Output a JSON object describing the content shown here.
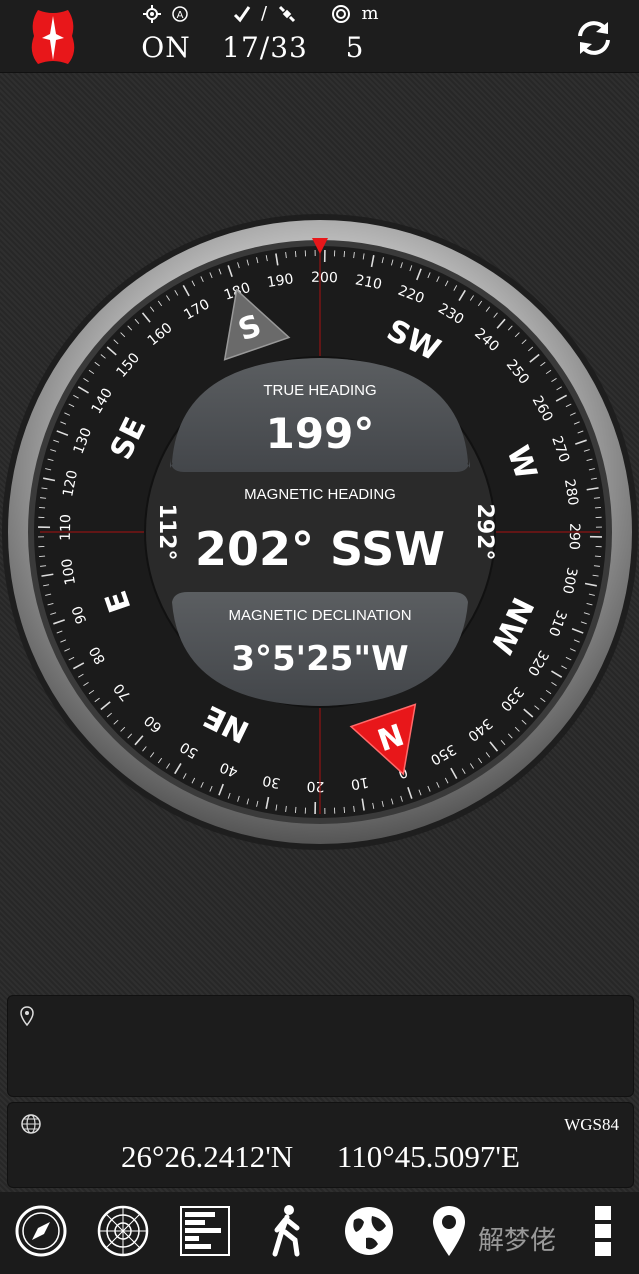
{
  "status_bar": {
    "gps_state": "ON",
    "satellites": "17/33",
    "accuracy": "5",
    "accuracy_unit": "m"
  },
  "compass": {
    "true_heading_label": "TRUE HEADING",
    "true_heading": "199°",
    "magnetic_heading_label": "MAGNETIC HEADING",
    "magnetic_heading": "202° SSW",
    "magnetic_declination_label": "MAGNETIC DECLINATION",
    "magnetic_declination": "3°5'25\"W",
    "left_bearing": "112°",
    "right_bearing": "292°",
    "rotation_deg": 199,
    "cardinals": [
      "N",
      "NE",
      "E",
      "SE",
      "S",
      "SW",
      "W",
      "NW"
    ]
  },
  "location": {
    "datum": "WGS84",
    "latitude": "26°26.2412'N",
    "longitude": "110°45.5097'E"
  },
  "bottom_nav": [
    {
      "icon": "compass-icon"
    },
    {
      "icon": "radar-icon"
    },
    {
      "icon": "level-bars-icon"
    },
    {
      "icon": "walking-icon"
    },
    {
      "icon": "globe-icon"
    },
    {
      "icon": "map-pin-icon"
    },
    {
      "icon": "more-icon"
    }
  ],
  "watermark": "解梦佬",
  "colors": {
    "accent_red": "#e8171a",
    "bezel": "#c8c8c8",
    "panel": "#4e5154"
  }
}
